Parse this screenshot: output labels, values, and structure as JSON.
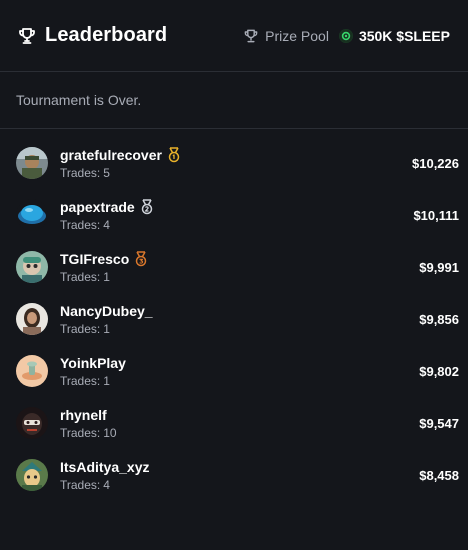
{
  "header": {
    "title": "Leaderboard",
    "prize_label": "Prize Pool",
    "prize_value": "350K $SLEEP"
  },
  "status": "Tournament is Over.",
  "trades_label": "Trades:",
  "entries": [
    {
      "name": "gratefulrecover",
      "trades": "5",
      "amount": "$10,226",
      "medal": "gold"
    },
    {
      "name": "papextrade",
      "trades": "4",
      "amount": "$10,111",
      "medal": "silver"
    },
    {
      "name": "TGIFresco",
      "trades": "1",
      "amount": "$9,991",
      "medal": "bronze"
    },
    {
      "name": "NancyDubey_",
      "trades": "1",
      "amount": "$9,856",
      "medal": ""
    },
    {
      "name": "YoinkPlay",
      "trades": "1",
      "amount": "$9,802",
      "medal": ""
    },
    {
      "name": "rhynelf",
      "trades": "10",
      "amount": "$9,547",
      "medal": ""
    },
    {
      "name": "ItsAditya_xyz",
      "trades": "4",
      "amount": "$8,458",
      "medal": ""
    }
  ],
  "colors": {
    "background": "#14161b",
    "divider": "#2b2e35",
    "muted_text": "#a8acb6",
    "gold": "#e8b12a",
    "silver": "#cfd3da",
    "bronze": "#d9772c",
    "token": "#37d46b"
  }
}
